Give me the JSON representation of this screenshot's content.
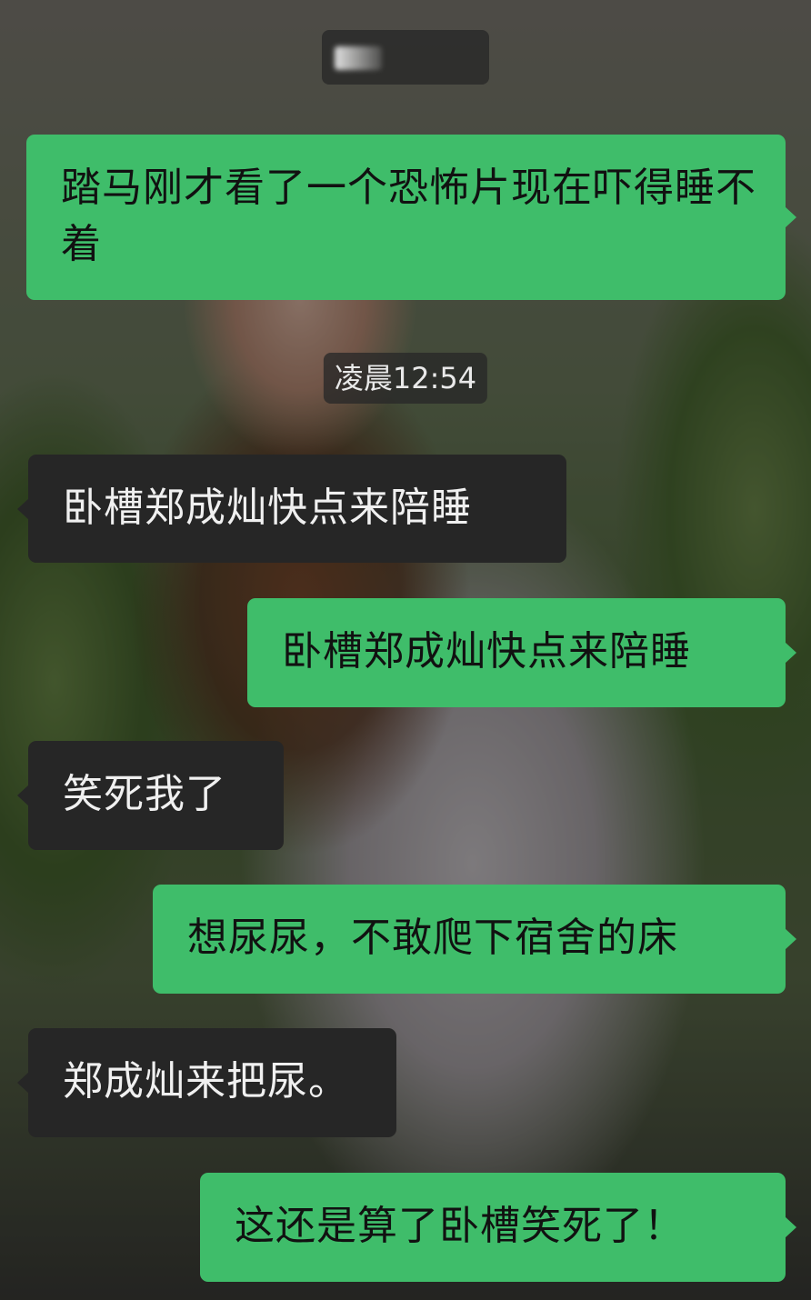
{
  "chat": {
    "contact_name_blurred": true,
    "timestamp": "凌晨12:54",
    "messages": [
      {
        "side": "out",
        "text": "踏马刚才看了一个恐怖片现在吓得睡不着"
      },
      {
        "side": "in",
        "text": "卧槽郑成灿快点来陪睡"
      },
      {
        "side": "out",
        "text": "卧槽郑成灿快点来陪睡"
      },
      {
        "side": "in",
        "text": "笑死我了"
      },
      {
        "side": "out",
        "text": "想尿尿，不敢爬下宿舍的床"
      },
      {
        "side": "in",
        "text": "郑成灿来把尿。"
      },
      {
        "side": "out",
        "text": "这还是算了卧槽笑死了！"
      }
    ]
  },
  "colors": {
    "outgoing_bubble": "#3fbd6a",
    "incoming_bubble": "#262626",
    "outgoing_text": "#111111",
    "incoming_text": "#f0f0f0"
  }
}
